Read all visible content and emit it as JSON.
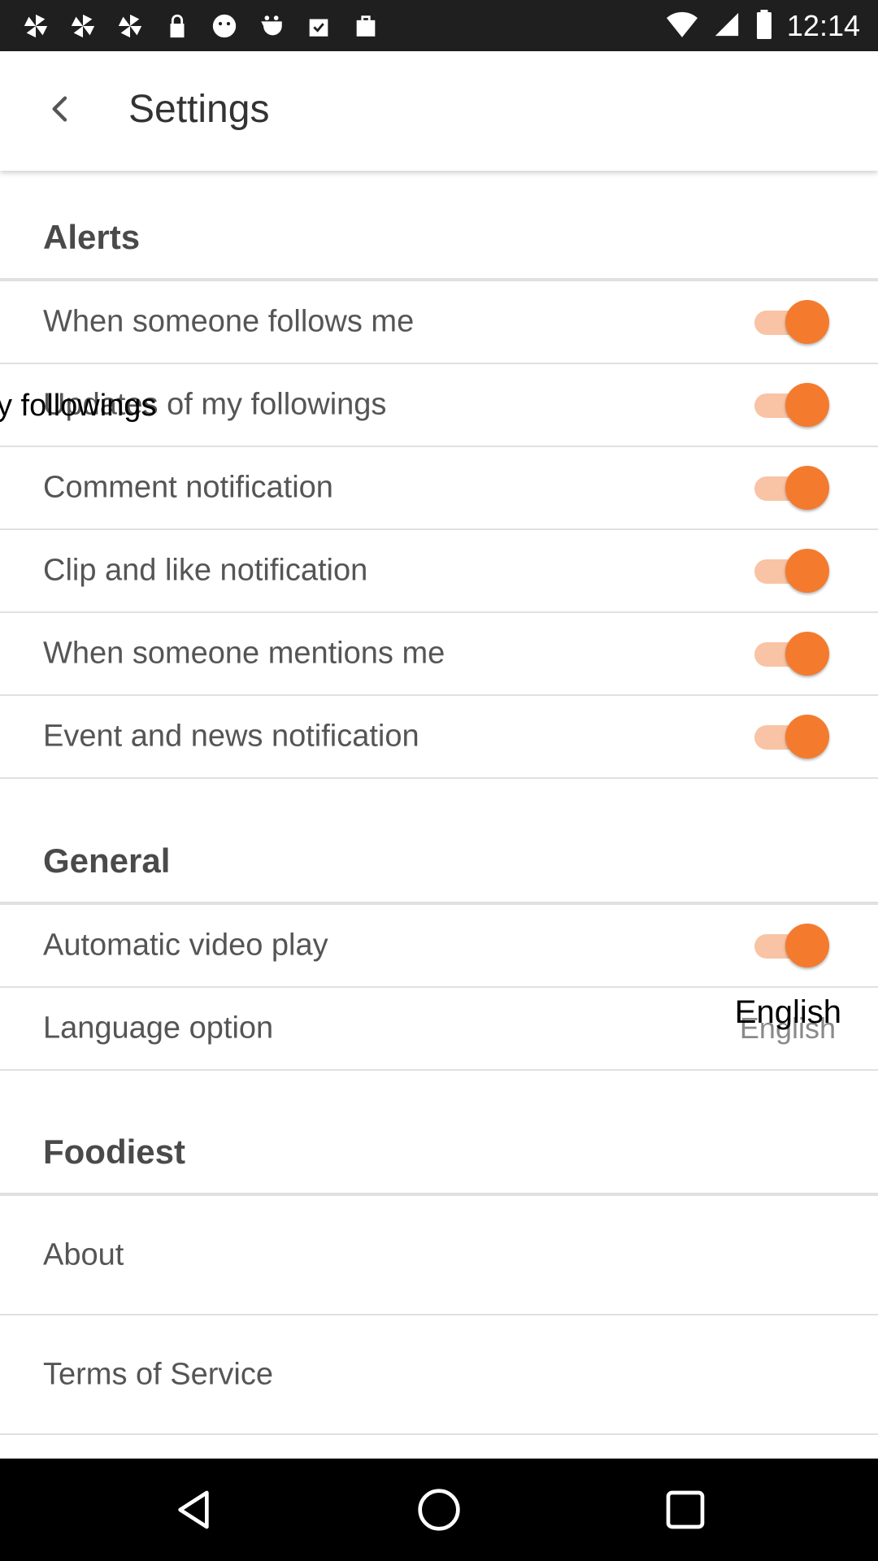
{
  "status_bar": {
    "time": "12:14",
    "left_icons": [
      "pinwheel-icon",
      "pinwheel-icon",
      "pinwheel-icon",
      "lock-icon",
      "face-icon",
      "cookie-icon",
      "checkbox-bag-icon",
      "shopping-bag-icon"
    ],
    "right_icons": [
      "wifi-icon",
      "signal-icon",
      "battery-icon"
    ]
  },
  "app_bar": {
    "title": "Settings",
    "back_icon": "back-arrow-icon"
  },
  "sections": {
    "alerts": {
      "title": "Alerts",
      "items": [
        {
          "label": "When someone follows me",
          "toggle": true
        },
        {
          "label": "Updates of my followings",
          "overlay_label": "y followings",
          "toggle": true
        },
        {
          "label": "Comment notification",
          "toggle": true
        },
        {
          "label": "Clip and like notification",
          "toggle": true
        },
        {
          "label": "When someone mentions me",
          "toggle": true
        },
        {
          "label": "Event and news notification",
          "toggle": true
        }
      ]
    },
    "general": {
      "title": "General",
      "items": [
        {
          "label": "Automatic video play",
          "toggle": true
        },
        {
          "label": "Language option",
          "value": "English",
          "overlay_value": "English"
        }
      ]
    },
    "foodiest": {
      "title": "Foodiest",
      "items": [
        {
          "label": "About"
        },
        {
          "label": "Terms of Service"
        }
      ]
    }
  },
  "colors": {
    "accent": "#f47b2e",
    "accent_track": "#f9c3a5",
    "divider": "#e0e0e0"
  },
  "nav_bar": {
    "icons": [
      "back-triangle-icon",
      "home-circle-icon",
      "recents-square-icon"
    ]
  }
}
